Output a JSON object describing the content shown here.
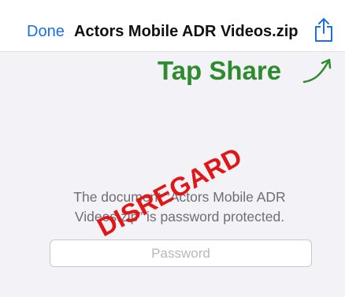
{
  "nav": {
    "done_label": "Done",
    "title": "Actors Mobile ADR Videos.zip",
    "share_icon": "share-icon"
  },
  "annotation": {
    "text": "Tap Share",
    "arrow_icon": "curved-arrow-up-right-icon",
    "color": "#2e8b2e"
  },
  "content": {
    "message": "The document “Actors Mobile ADR Videos.zip” is password protected.",
    "password_placeholder": "Password",
    "password_value": ""
  },
  "watermark": {
    "text": "DISREGARD",
    "color": "#e11616"
  },
  "colors": {
    "accent": "#1a6fe5",
    "background": "#f2f2f7"
  }
}
